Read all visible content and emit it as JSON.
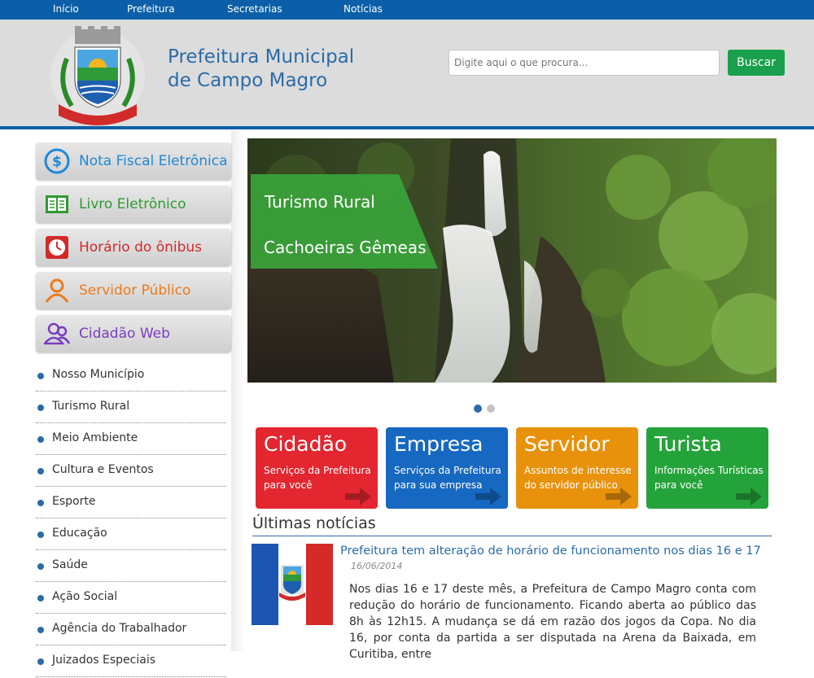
{
  "nav": {
    "items": [
      {
        "label": "Início"
      },
      {
        "label": "Prefeitura"
      },
      {
        "label": "Secretarias"
      },
      {
        "label": "Notícias"
      }
    ]
  },
  "header": {
    "logo_text": "CAMPO MAGRO",
    "title_line1": "Prefeitura Municipal",
    "title_line2": "de Campo Magro",
    "search_placeholder": "Digite aqui o que procura...",
    "search_button": "Buscar"
  },
  "sidebar": {
    "quick_links": [
      {
        "label": "Nota Fiscal Eletrônica",
        "icon": "dollar-coin-icon",
        "color": "#1e88d9"
      },
      {
        "label": "Livro Eletrônico",
        "icon": "open-book-icon",
        "color": "#2e9a2e"
      },
      {
        "label": "Horário do ônibus",
        "icon": "clock-icon",
        "color": "#d42a2a"
      },
      {
        "label": "Servidor Público",
        "icon": "person-icon",
        "color": "#ef7a1a"
      },
      {
        "label": "Cidadão Web",
        "icon": "people-icon",
        "color": "#7a3dc0"
      }
    ],
    "links": [
      {
        "label": "Nosso Município"
      },
      {
        "label": "Turismo Rural"
      },
      {
        "label": "Meio Ambiente"
      },
      {
        "label": "Cultura e Eventos"
      },
      {
        "label": "Esporte"
      },
      {
        "label": "Educação"
      },
      {
        "label": "Saúde"
      },
      {
        "label": "Ação Social"
      },
      {
        "label": "Agência do Trabalhador"
      },
      {
        "label": "Juizados Especiais"
      }
    ]
  },
  "slider": {
    "caption_line1": "Turismo Rural",
    "caption_line2": "Cachoeiras Gêmeas",
    "caption_color": "#3aa23a",
    "active_dot": 0,
    "dot_count": 2
  },
  "tiles": [
    {
      "title": "Cidadão",
      "subtitle": "Serviços da Prefeitura para você",
      "color": "#e3262f"
    },
    {
      "title": "Empresa",
      "subtitle": "Serviços da Prefeitura para sua empresa",
      "color": "#1668c1"
    },
    {
      "title": "Servidor",
      "subtitle": "Assuntos de interesse do servidor público",
      "color": "#e8920b"
    },
    {
      "title": "Turista",
      "subtitle": "Informações Turísticas para você",
      "color": "#25a33b"
    }
  ],
  "news": {
    "heading": "Últimas notícias",
    "items": [
      {
        "title": "Prefeitura tem alteração de horário de funcionamento nos dias 16 e 17",
        "date": "16/06/2014",
        "body": "Nos dias 16 e 17 deste mês, a Prefeitura de Campo Magro conta com redução do horário de funcionamento. Ficando aberta ao público das 8h às 12h15. A mudança se dá em razão dos jogos da Copa. No dia 16, por conta da partida a ser disputada na Arena da Baixada, em Curitiba, entre"
      }
    ]
  },
  "colors": {
    "brand_blue": "#0a5fa8",
    "header_bg": "#dcdcdc",
    "search_green": "#1aa04c"
  }
}
